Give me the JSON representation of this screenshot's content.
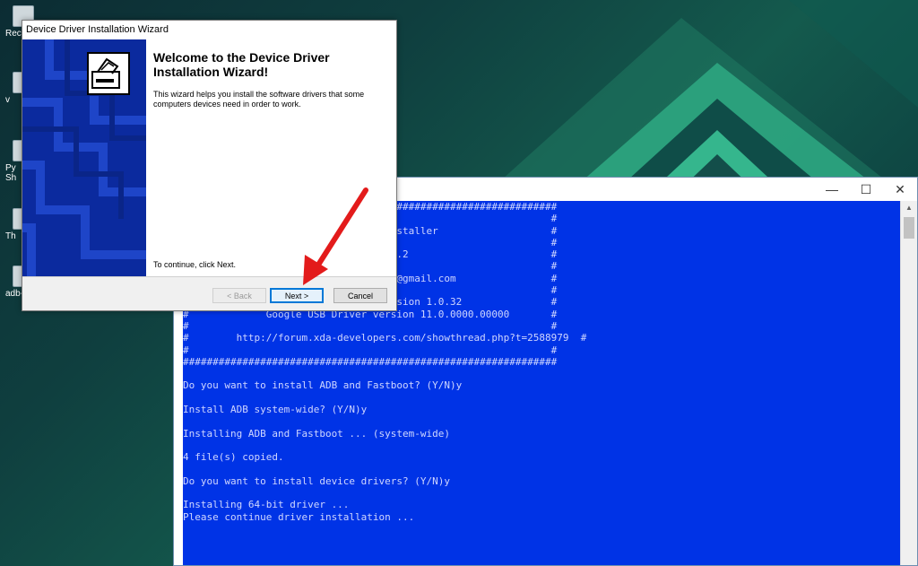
{
  "desktop": {
    "icons": [
      {
        "label": "Rec",
        "icon": "recycle-bin-icon"
      },
      {
        "label": "v",
        "icon": "file-icon"
      },
      {
        "label": "Py\nSh",
        "icon": "python-shortcut-icon"
      },
      {
        "label": "Th",
        "icon": "file-icon"
      },
      {
        "label": "adb-",
        "icon": "file-icon"
      }
    ]
  },
  "console": {
    "controls": {
      "minimize": "—",
      "maximize": "☐",
      "close": "✕"
    },
    "lines": [
      "###############################################################",
      "#                                                             #",
      "#                          ds ADB Installer                   #",
      "#                                                             #",
      "#                         ersion 1.4.2                        #",
      "#                                                             #",
      "#                         . Snoop05B@gmail.com                #",
      "#                                                             #",
      "#                         Bridge version 1.0.32               #",
      "#             Google USB Driver version 11.0.0000.00000       #",
      "#                                                             #",
      "#        http://forum.xda-developers.com/showthread.php?t=2588979  #",
      "#                                                             #",
      "###############################################################",
      "",
      "Do you want to install ADB and Fastboot? (Y/N)y",
      "",
      "Install ADB system-wide? (Y/N)y",
      "",
      "Installing ADB and Fastboot ... (system-wide)",
      "",
      "4 file(s) copied.",
      "",
      "Do you want to install device drivers? (Y/N)y",
      "",
      "Installing 64-bit driver ...",
      "Please continue driver installation ..."
    ]
  },
  "wizard": {
    "title": "Device Driver Installation Wizard",
    "heading": "Welcome to the Device Driver Installation Wizard!",
    "description": "This wizard helps you install the software drivers that some computers devices need in order to work.",
    "continue_text": "To continue, click Next.",
    "buttons": {
      "back": "< Back",
      "next": "Next >",
      "cancel": "Cancel"
    }
  },
  "colors": {
    "console_bg": "#0033e6",
    "banner_bg": "#0b2a9e",
    "arrow": "#e31b1b"
  }
}
